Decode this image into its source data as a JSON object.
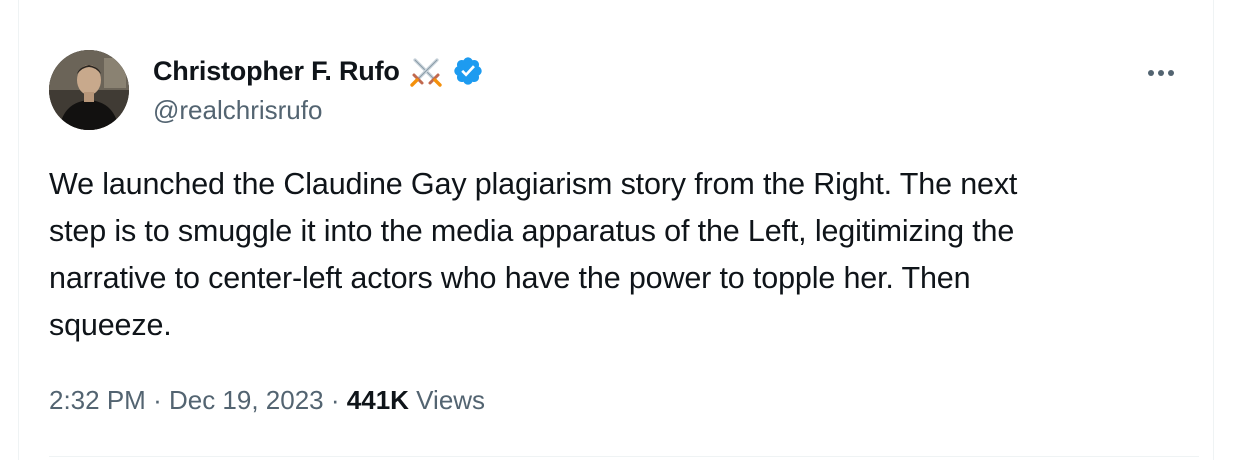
{
  "author": {
    "display_name": "Christopher F. Rufo",
    "handle": "@realchrisrufo",
    "name_emoji": "crossed-swords-emoji",
    "verified_badge_color": "#1d9bf0"
  },
  "tweet": {
    "text": "We launched the Claudine Gay plagiarism story from the Right. The next\nstep is to smuggle it into the media apparatus of the Left, legitimizing the\nnarrative to center-left actors who have the power to topple her. Then\nsqueeze.",
    "time": "2:32 PM",
    "separator": "·",
    "date": "Dec 19, 2023",
    "views_count": "441K",
    "views_label": "Views"
  },
  "icons": {
    "more": "more-horizontal-icon",
    "verified": "verified-badge-icon"
  },
  "colors": {
    "text_primary": "#0f1419",
    "text_secondary": "#536471",
    "border": "#eff3f4"
  }
}
